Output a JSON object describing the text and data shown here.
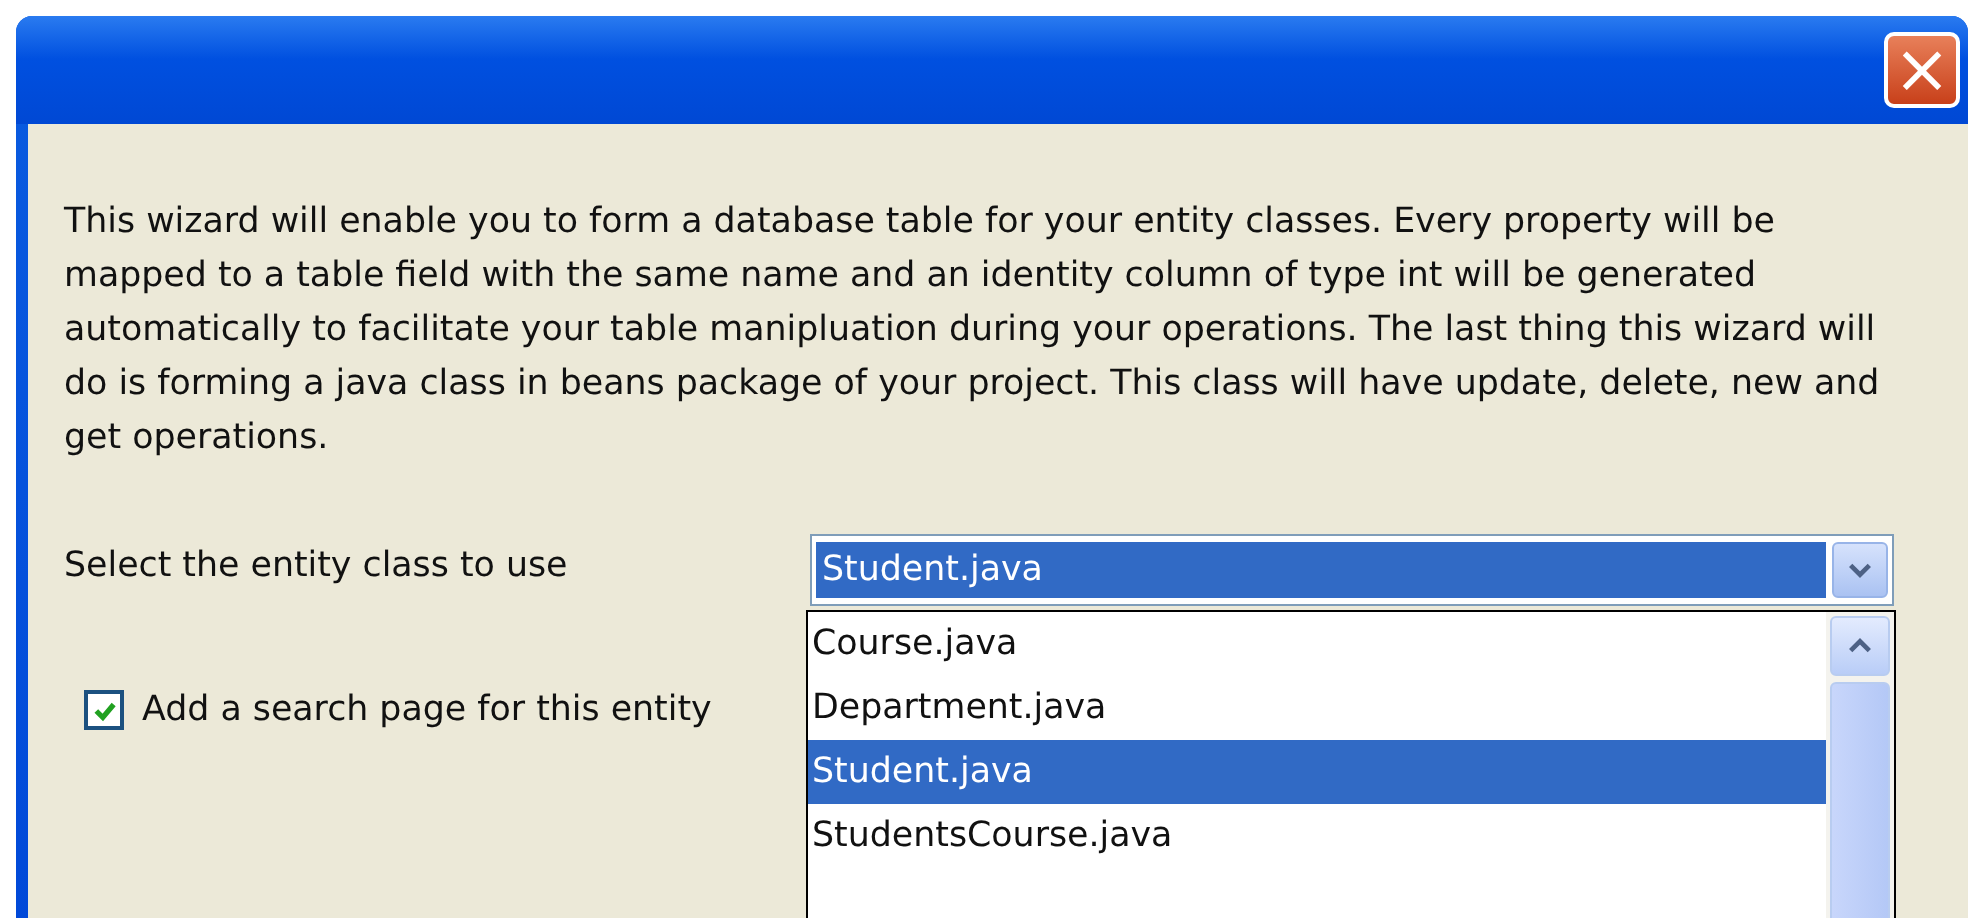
{
  "window": {
    "close_icon": "×"
  },
  "description": "This wizard will enable you to form a database table for your entity classes. Every property will be mapped to a table field with the same name and an identity column of type int will be generated automatically to facilitate your table manipluation during your operations. The last thing this wizard will do is forming a java class in beans package of your project. This class will have update, delete, new and get operations.",
  "entity_select": {
    "label": "Select the entity class to use",
    "value": "Student.java",
    "expanded": true,
    "options": [
      {
        "label": "Course.java",
        "selected": false
      },
      {
        "label": "Department.java",
        "selected": false
      },
      {
        "label": "Student.java",
        "selected": true
      },
      {
        "label": "StudentsCourse.java",
        "selected": false
      }
    ]
  },
  "search_page": {
    "label": "Add a search page for this entity",
    "checked": true
  }
}
